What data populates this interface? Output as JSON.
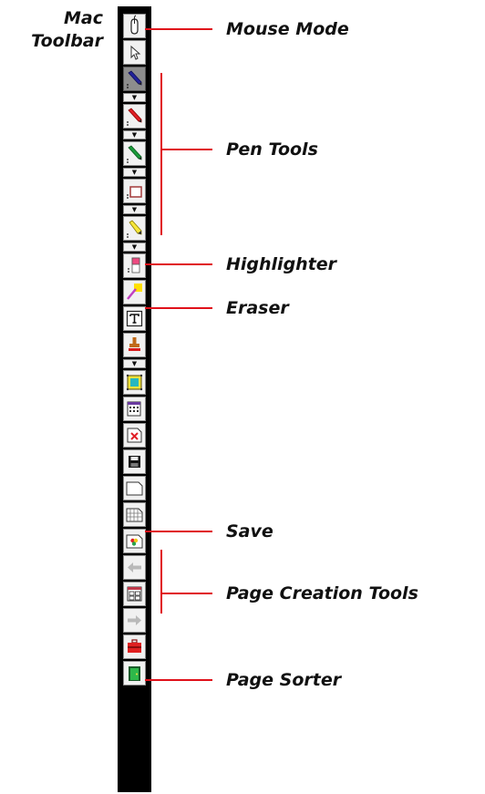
{
  "title": {
    "line1": "Mac",
    "line2": "Toolbar"
  },
  "labels": {
    "mouse_mode": "Mouse Mode",
    "pen_tools": "Pen Tools",
    "highlighter": "Highlighter",
    "eraser": "Eraser",
    "save": "Save",
    "page_creation_tools": "Page Creation Tools",
    "page_sorter": "Page Sorter"
  },
  "dropdown_glyph": "▼",
  "colors": {
    "callout": "#e0111a",
    "toolbar_frame": "#000000",
    "button_face": "#f1f1f1"
  },
  "tools": [
    {
      "name": "mouse-icon"
    },
    {
      "name": "pointer-icon"
    },
    {
      "name": "blue-pen-icon"
    },
    {
      "name": "red-pen-icon"
    },
    {
      "name": "green-pen-icon"
    },
    {
      "name": "shape-pen-icon"
    },
    {
      "name": "highlighter-icon"
    },
    {
      "name": "eraser-icon"
    },
    {
      "name": "magic-pen-icon"
    },
    {
      "name": "text-icon"
    },
    {
      "name": "stamp-icon"
    },
    {
      "name": "screen-capture-icon"
    },
    {
      "name": "gallery-icon"
    },
    {
      "name": "delete-page-icon"
    },
    {
      "name": "save-icon"
    },
    {
      "name": "blank-page-icon"
    },
    {
      "name": "grid-page-icon"
    },
    {
      "name": "background-page-icon"
    },
    {
      "name": "back-arrow-icon"
    },
    {
      "name": "page-sorter-icon"
    },
    {
      "name": "forward-arrow-icon"
    },
    {
      "name": "toolbox-icon"
    },
    {
      "name": "exit-icon"
    }
  ]
}
